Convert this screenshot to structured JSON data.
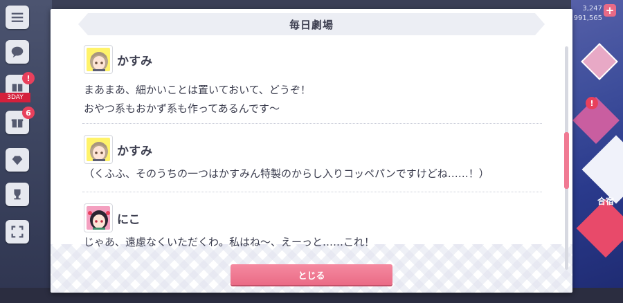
{
  "background": {
    "currency_lines": [
      "3,247",
      "991,565"
    ],
    "red_tag": "3DAY",
    "badge_counts": [
      "!",
      "6",
      "!"
    ],
    "right_label": "合宿"
  },
  "dialog": {
    "title": "毎日劇場",
    "entries": [
      {
        "speaker": "かすみ",
        "avatar": "kasumi-avatar",
        "lines": [
          "まあまあ、細かいことは置いておいて、どうぞ！",
          "おやつ系もおかず系も作ってあるんです～"
        ]
      },
      {
        "speaker": "かすみ",
        "avatar": "kasumi-avatar",
        "lines": [
          "（くふふ、そのうちの一つはかすみん特製のからし入りコッペパンですけどね……！）"
        ]
      },
      {
        "speaker": "にこ",
        "avatar": "nico-avatar",
        "lines": [
          "じゃあ、遠慮なくいただくわ。私はね～、えーっと……これ！"
        ]
      }
    ],
    "scroll_position": 0.42,
    "close_label": "とじる"
  },
  "colors": {
    "accent": "#ea6b86",
    "text": "#3b3d4e",
    "title_bar": "#eceef4",
    "kasumi_bg": "#fff36a",
    "nico_bg": "#f4a0c0"
  }
}
